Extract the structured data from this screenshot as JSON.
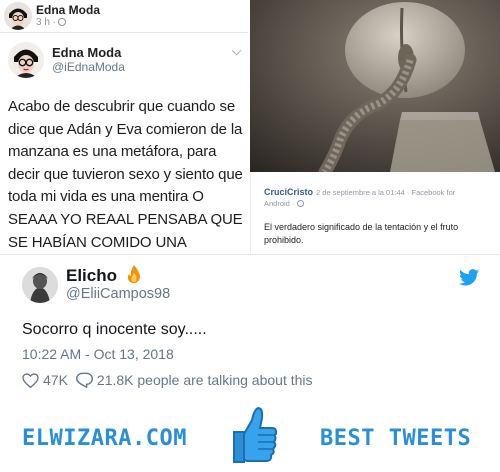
{
  "fb_post": {
    "author": "Edna Moda",
    "time": "3 h ·"
  },
  "embedded_tweet": {
    "name": "Edna Moda",
    "handle": "@iEdnaModa",
    "text": "Acabo de descubrir que cuando se dice que Adán y Eva comieron de la manzana es una metáfora, para decir que tuvieron sexo y siento que toda mi vida es una mentira O SEAAA YO REAAL PENSABA QUE SE HABÍAN COMIDO UNA FRUTITA."
  },
  "fb_comment": {
    "author": "CruciCristo",
    "meta": "2 de septiembre a la 01:44 · Facebook for",
    "meta2": "Android · ",
    "text": "El verdadero significado de la tentación y el fruto prohibido."
  },
  "tweet": {
    "name": "Elicho",
    "handle": "@EliiCampos98",
    "text": "Socorro q inocente soy.....",
    "time": "10:22 AM - Oct 13, 2018",
    "likes": "47K",
    "talking": "21.8K people are talking about this"
  },
  "banner": {
    "left": "ELWIZARA.COM",
    "right": "BEST TWEETS"
  },
  "icons": {
    "fb_avatar": "edna-mode-avatar",
    "twitter_logo": "twitter-bird-icon",
    "heart": "heart-icon",
    "comment": "comment-icon",
    "thumb": "thumbs-up-icon",
    "fire": "fire-emoji-icon"
  },
  "colors": {
    "twitter_blue": "#1da1f2",
    "banner_blue": "#2a8fd6",
    "text_gray": "#657786"
  }
}
